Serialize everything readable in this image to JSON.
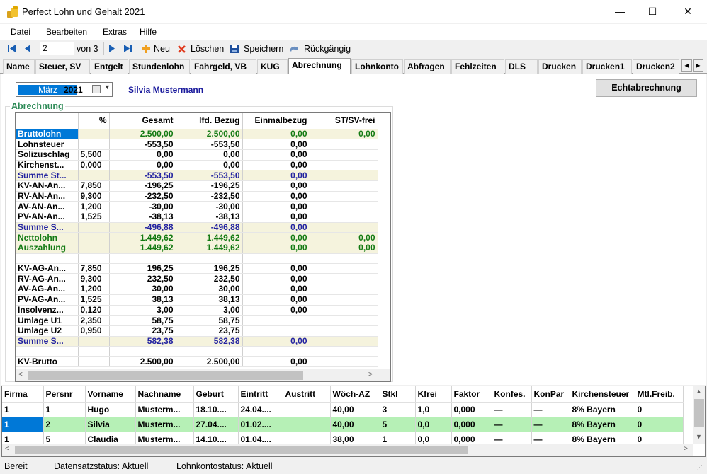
{
  "window": {
    "title": "Perfect Lohn und Gehalt 2021",
    "minimize": "—",
    "maximize": "☐",
    "close": "✕"
  },
  "menu": [
    "Datei",
    "Bearbeiten",
    "Extras",
    "Hilfe"
  ],
  "toolbar": {
    "record": "2",
    "of_label": "von 3",
    "new_label": "Neu",
    "delete_label": "Löschen",
    "save_label": "Speichern",
    "undo_label": "Rückgängig"
  },
  "tabs": [
    "Name",
    "Steuer, SV",
    "Entgelt",
    "Stundenlohn",
    "Fahrgeld, VB",
    "KUG",
    "Abrechnung",
    "Lohnkonto",
    "Abfragen",
    "Fehlzeiten",
    "DLS",
    "Drucken",
    "Drucken1",
    "Drucken2"
  ],
  "active_tab": "Abrechnung",
  "period": {
    "month": "März",
    "year": "2021"
  },
  "employee_name": "Silvia Mustermann",
  "echt_button": "Echtabrechnung",
  "group_title": "Abrechnung",
  "calc_grid": {
    "columns": [
      "",
      "%",
      "Gesamt",
      "lfd. Bezug",
      "Einmalbezug",
      "ST/SV-frei"
    ],
    "rows": [
      {
        "label": "Bruttolohn",
        "pct": "",
        "gesamt": "2.500,00",
        "lfd": "2.500,00",
        "einmal": "0,00",
        "frei": "0,00",
        "style": "brutto"
      },
      {
        "label": "Lohnsteuer",
        "pct": "",
        "gesamt": "-553,50",
        "lfd": "-553,50",
        "einmal": "0,00",
        "frei": "",
        "style": ""
      },
      {
        "label": "Solizuschlag",
        "pct": "5,500",
        "gesamt": "0,00",
        "lfd": "0,00",
        "einmal": "0,00",
        "frei": "",
        "style": ""
      },
      {
        "label": "Kirchenst...",
        "pct": "0,000",
        "gesamt": "0,00",
        "lfd": "0,00",
        "einmal": "0,00",
        "frei": "",
        "style": ""
      },
      {
        "label": "Summe St...",
        "pct": "",
        "gesamt": "-553,50",
        "lfd": "-553,50",
        "einmal": "0,00",
        "frei": "",
        "style": "sum"
      },
      {
        "label": "KV-AN-An...",
        "pct": "7,850",
        "gesamt": "-196,25",
        "lfd": "-196,25",
        "einmal": "0,00",
        "frei": "",
        "style": ""
      },
      {
        "label": "RV-AN-An...",
        "pct": "9,300",
        "gesamt": "-232,50",
        "lfd": "-232,50",
        "einmal": "0,00",
        "frei": "",
        "style": ""
      },
      {
        "label": "AV-AN-An...",
        "pct": "1,200",
        "gesamt": "-30,00",
        "lfd": "-30,00",
        "einmal": "0,00",
        "frei": "",
        "style": ""
      },
      {
        "label": "PV-AN-An...",
        "pct": "1,525",
        "gesamt": "-38,13",
        "lfd": "-38,13",
        "einmal": "0,00",
        "frei": "",
        "style": ""
      },
      {
        "label": "Summe S...",
        "pct": "",
        "gesamt": "-496,88",
        "lfd": "-496,88",
        "einmal": "0,00",
        "frei": "",
        "style": "sum"
      },
      {
        "label": "Nettolohn",
        "pct": "",
        "gesamt": "1.449,62",
        "lfd": "1.449,62",
        "einmal": "0,00",
        "frei": "0,00",
        "style": "green"
      },
      {
        "label": "Auszahlung",
        "pct": "",
        "gesamt": "1.449,62",
        "lfd": "1.449,62",
        "einmal": "0,00",
        "frei": "0,00",
        "style": "green"
      },
      {
        "label": "",
        "pct": "",
        "gesamt": "",
        "lfd": "",
        "einmal": "",
        "frei": "",
        "style": "blank"
      },
      {
        "label": "KV-AG-An...",
        "pct": "7,850",
        "gesamt": "196,25",
        "lfd": "196,25",
        "einmal": "0,00",
        "frei": "",
        "style": ""
      },
      {
        "label": "RV-AG-An...",
        "pct": "9,300",
        "gesamt": "232,50",
        "lfd": "232,50",
        "einmal": "0,00",
        "frei": "",
        "style": ""
      },
      {
        "label": "AV-AG-An...",
        "pct": "1,200",
        "gesamt": "30,00",
        "lfd": "30,00",
        "einmal": "0,00",
        "frei": "",
        "style": ""
      },
      {
        "label": "PV-AG-An...",
        "pct": "1,525",
        "gesamt": "38,13",
        "lfd": "38,13",
        "einmal": "0,00",
        "frei": "",
        "style": ""
      },
      {
        "label": "Insolvenz...",
        "pct": "0,120",
        "gesamt": "3,00",
        "lfd": "3,00",
        "einmal": "0,00",
        "frei": "",
        "style": ""
      },
      {
        "label": "Umlage U1",
        "pct": "2,350",
        "gesamt": "58,75",
        "lfd": "58,75",
        "einmal": "",
        "frei": "",
        "style": ""
      },
      {
        "label": "Umlage U2",
        "pct": "0,950",
        "gesamt": "23,75",
        "lfd": "23,75",
        "einmal": "",
        "frei": "",
        "style": ""
      },
      {
        "label": "Summe S...",
        "pct": "",
        "gesamt": "582,38",
        "lfd": "582,38",
        "einmal": "0,00",
        "frei": "",
        "style": "sum"
      },
      {
        "label": "",
        "pct": "",
        "gesamt": "",
        "lfd": "",
        "einmal": "",
        "frei": "",
        "style": "blank"
      },
      {
        "label": "KV-Brutto",
        "pct": "",
        "gesamt": "2.500,00",
        "lfd": "2.500,00",
        "einmal": "0,00",
        "frei": "",
        "style": ""
      }
    ]
  },
  "employee_grid": {
    "columns": [
      "Firma",
      "Persnr",
      "Vorname",
      "Nachname",
      "Geburt",
      "Eintritt",
      "Austritt",
      "Wöch-AZ",
      "Stkl",
      "Kfrei",
      "Faktor",
      "Konfes.",
      "KonPar",
      "Kirchensteuer",
      "Mtl.Freib."
    ],
    "rows": [
      [
        "1",
        "1",
        "Hugo",
        "Musterm...",
        "18.10....",
        "24.04....",
        "",
        "40,00",
        "3",
        "1,0",
        "0,000",
        "—",
        "—",
        "8% Bayern",
        "0"
      ],
      [
        "1",
        "2",
        "Silvia",
        "Musterm...",
        "27.04....",
        "01.02....",
        "",
        "40,00",
        "5",
        "0,0",
        "0,000",
        "—",
        "—",
        "8% Bayern",
        "0"
      ],
      [
        "1",
        "5",
        "Claudia",
        "Musterm...",
        "14.10....",
        "01.04....",
        "",
        "38,00",
        "1",
        "0,0",
        "0,000",
        "—",
        "—",
        "8% Bayern",
        "0"
      ]
    ],
    "selected_row": 1
  },
  "statusbar": {
    "state": "Bereit",
    "record_status": "Datensatzstatus:  Aktuell",
    "account_status": "Lohnkontostatus:  Aktuell"
  },
  "colors": {
    "selection": "#0078d7",
    "sum_row_text": "#2323a0",
    "net_text": "#137a13",
    "selected_row_bg": "#b6f0b6",
    "highlight_row_bg": "#f5f3dd"
  }
}
